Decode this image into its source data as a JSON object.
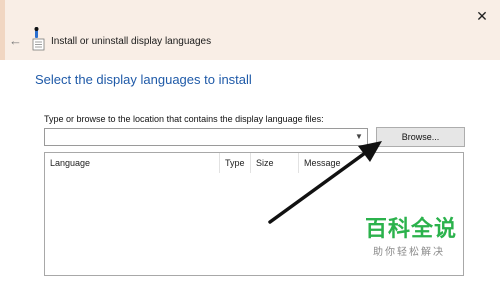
{
  "window": {
    "title": "Install or uninstall display languages",
    "close_glyph": "✕",
    "back_glyph": "←"
  },
  "main": {
    "heading": "Select the display languages to install",
    "path_label": "Type or browse to the location that contains the display language files:",
    "path_value": "",
    "browse_label": "Browse..."
  },
  "table": {
    "columns": [
      "Language",
      "Type",
      "Size",
      "Message"
    ]
  },
  "watermark": {
    "main": "百科全说",
    "sub": "助你轻松解决"
  },
  "colors": {
    "heading": "#1f5aa8",
    "arrow": "#111111",
    "watermark_green": "#2bb24c"
  },
  "icons": {
    "back": "back-arrow-icon",
    "app": "language-install-icon",
    "close": "close-icon",
    "dropdown": "chevron-down-icon"
  }
}
